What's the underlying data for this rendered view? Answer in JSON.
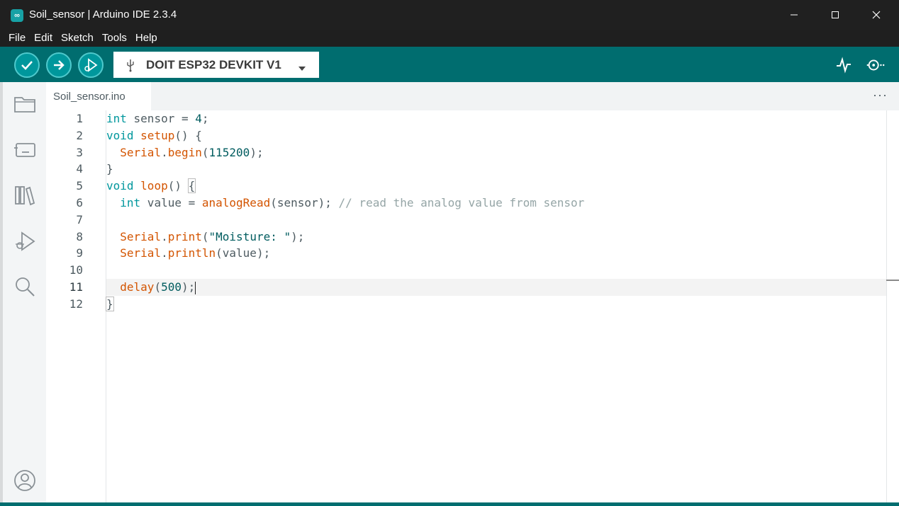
{
  "window": {
    "title": "Soil_sensor | Arduino IDE 2.3.4",
    "app_icon_glyph": "∞"
  },
  "menu": [
    "File",
    "Edit",
    "Sketch",
    "Tools",
    "Help"
  ],
  "toolbar": {
    "board": "DOIT ESP32 DEVKIT V1",
    "accent": "#006d6f",
    "button_color": "#00979c"
  },
  "sidebar": {
    "icons": [
      "folder-icon",
      "board-icon",
      "library-icon",
      "debug-icon",
      "search-icon",
      "account-icon"
    ]
  },
  "tab": {
    "label": "Soil_sensor.ino",
    "more": "···"
  },
  "editor": {
    "current_line": 11,
    "line_numbers": [
      "1",
      "2",
      "3",
      "4",
      "5",
      "6",
      "7",
      "8",
      "9",
      "10",
      "11",
      "12"
    ],
    "lines": [
      [
        {
          "t": "int",
          "c": "kw"
        },
        {
          "t": " sensor = ",
          "c": ""
        },
        {
          "t": "4",
          "c": "num"
        },
        {
          "t": ";",
          "c": ""
        }
      ],
      [
        {
          "t": "void",
          "c": "kw"
        },
        {
          "t": " ",
          "c": ""
        },
        {
          "t": "setup",
          "c": "fn"
        },
        {
          "t": "() {",
          "c": ""
        }
      ],
      [
        {
          "t": "  ",
          "c": ""
        },
        {
          "t": "Serial",
          "c": "fn"
        },
        {
          "t": ".",
          "c": ""
        },
        {
          "t": "begin",
          "c": "fn"
        },
        {
          "t": "(",
          "c": ""
        },
        {
          "t": "115200",
          "c": "num"
        },
        {
          "t": ");",
          "c": ""
        }
      ],
      [
        {
          "t": "}",
          "c": ""
        }
      ],
      [
        {
          "t": "void",
          "c": "kw"
        },
        {
          "t": " ",
          "c": ""
        },
        {
          "t": "loop",
          "c": "fn"
        },
        {
          "t": "() ",
          "c": ""
        },
        {
          "t": "{",
          "c": "box"
        }
      ],
      [
        {
          "t": "  ",
          "c": ""
        },
        {
          "t": "int",
          "c": "kw"
        },
        {
          "t": " value = ",
          "c": ""
        },
        {
          "t": "analogRead",
          "c": "fn"
        },
        {
          "t": "(sensor); ",
          "c": ""
        },
        {
          "t": "// read the analog value from sensor",
          "c": "cm"
        }
      ],
      [],
      [
        {
          "t": "  ",
          "c": ""
        },
        {
          "t": "Serial",
          "c": "fn"
        },
        {
          "t": ".",
          "c": ""
        },
        {
          "t": "print",
          "c": "fn"
        },
        {
          "t": "(",
          "c": ""
        },
        {
          "t": "\"Moisture: \"",
          "c": "str"
        },
        {
          "t": ");",
          "c": ""
        }
      ],
      [
        {
          "t": "  ",
          "c": ""
        },
        {
          "t": "Serial",
          "c": "fn"
        },
        {
          "t": ".",
          "c": ""
        },
        {
          "t": "println",
          "c": "fn"
        },
        {
          "t": "(value);",
          "c": ""
        }
      ],
      [],
      [
        {
          "t": "  ",
          "c": ""
        },
        {
          "t": "delay",
          "c": "fn"
        },
        {
          "t": "(",
          "c": ""
        },
        {
          "t": "500",
          "c": "num"
        },
        {
          "t": ");",
          "c": ""
        },
        {
          "t": "",
          "c": "caret"
        }
      ],
      [
        {
          "t": "}",
          "c": "box"
        }
      ]
    ]
  }
}
